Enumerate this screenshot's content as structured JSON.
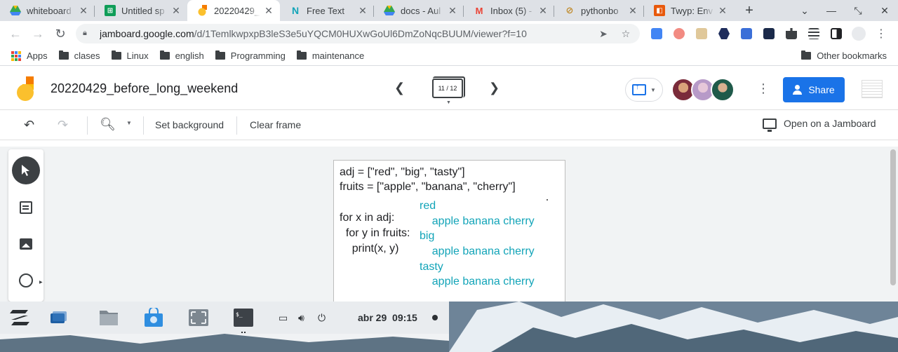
{
  "browser": {
    "tabs": [
      {
        "title": "whiteboard",
        "favicon": "google-drive-icon",
        "active": false
      },
      {
        "title": "Untitled sp",
        "favicon": "google-sheets-icon",
        "active": false
      },
      {
        "title": "20220429_",
        "favicon": "jamboard-icon",
        "active": true
      },
      {
        "title": "Free Text",
        "favicon": "notion-n-icon",
        "active": false
      },
      {
        "title": "docs - Aul",
        "favicon": "google-drive-icon",
        "active": false
      },
      {
        "title": "Inbox (5) -",
        "favicon": "gmail-icon",
        "active": false
      },
      {
        "title": "pythonbo",
        "favicon": "link-icon",
        "active": false
      },
      {
        "title": "Twyp: Env",
        "favicon": "orange-app-icon",
        "active": false
      }
    ],
    "new_tab": "+",
    "url_domain": "jamboard.google.com",
    "url_path": "/d/1TemlkwpxpB3leS3e5uYQCM0HUXwGoUl6DmZoNqcBUUM/viewer?f=10",
    "bookmarks": [
      {
        "label": "Apps",
        "icon": "apps-grid-icon"
      },
      {
        "label": "clases",
        "icon": "folder-icon"
      },
      {
        "label": "Linux",
        "icon": "folder-icon"
      },
      {
        "label": "english",
        "icon": "folder-icon"
      },
      {
        "label": "Programming",
        "icon": "folder-icon"
      },
      {
        "label": "maintenance",
        "icon": "folder-icon"
      }
    ],
    "other_bookmarks": "Other bookmarks"
  },
  "jamboard": {
    "title": "20220429_before_long_weekend",
    "frame_indicator": "11 / 12",
    "share_label": "Share",
    "toolbar": {
      "set_background": "Set background",
      "clear_frame": "Clear frame",
      "open_on_jamboard": "Open on a Jamboard"
    },
    "frame": {
      "code_lines": [
        "adj = [\"red\", \"big\", \"tasty\"]",
        "fruits = [\"apple\", \"banana\", \"cherry\"]",
        "for x in adj:",
        "  for y in fruits:",
        "    print(x, y)"
      ],
      "output_lines": [
        "red",
        "    apple banana cherry",
        "big",
        "    apple banana cherry",
        "tasty",
        "    apple banana cherry"
      ]
    },
    "colors": {
      "accent": "#1a73e8",
      "output_text": "#12a4b8"
    }
  },
  "taskbar": {
    "date": "abr 29",
    "time": "09:15"
  }
}
